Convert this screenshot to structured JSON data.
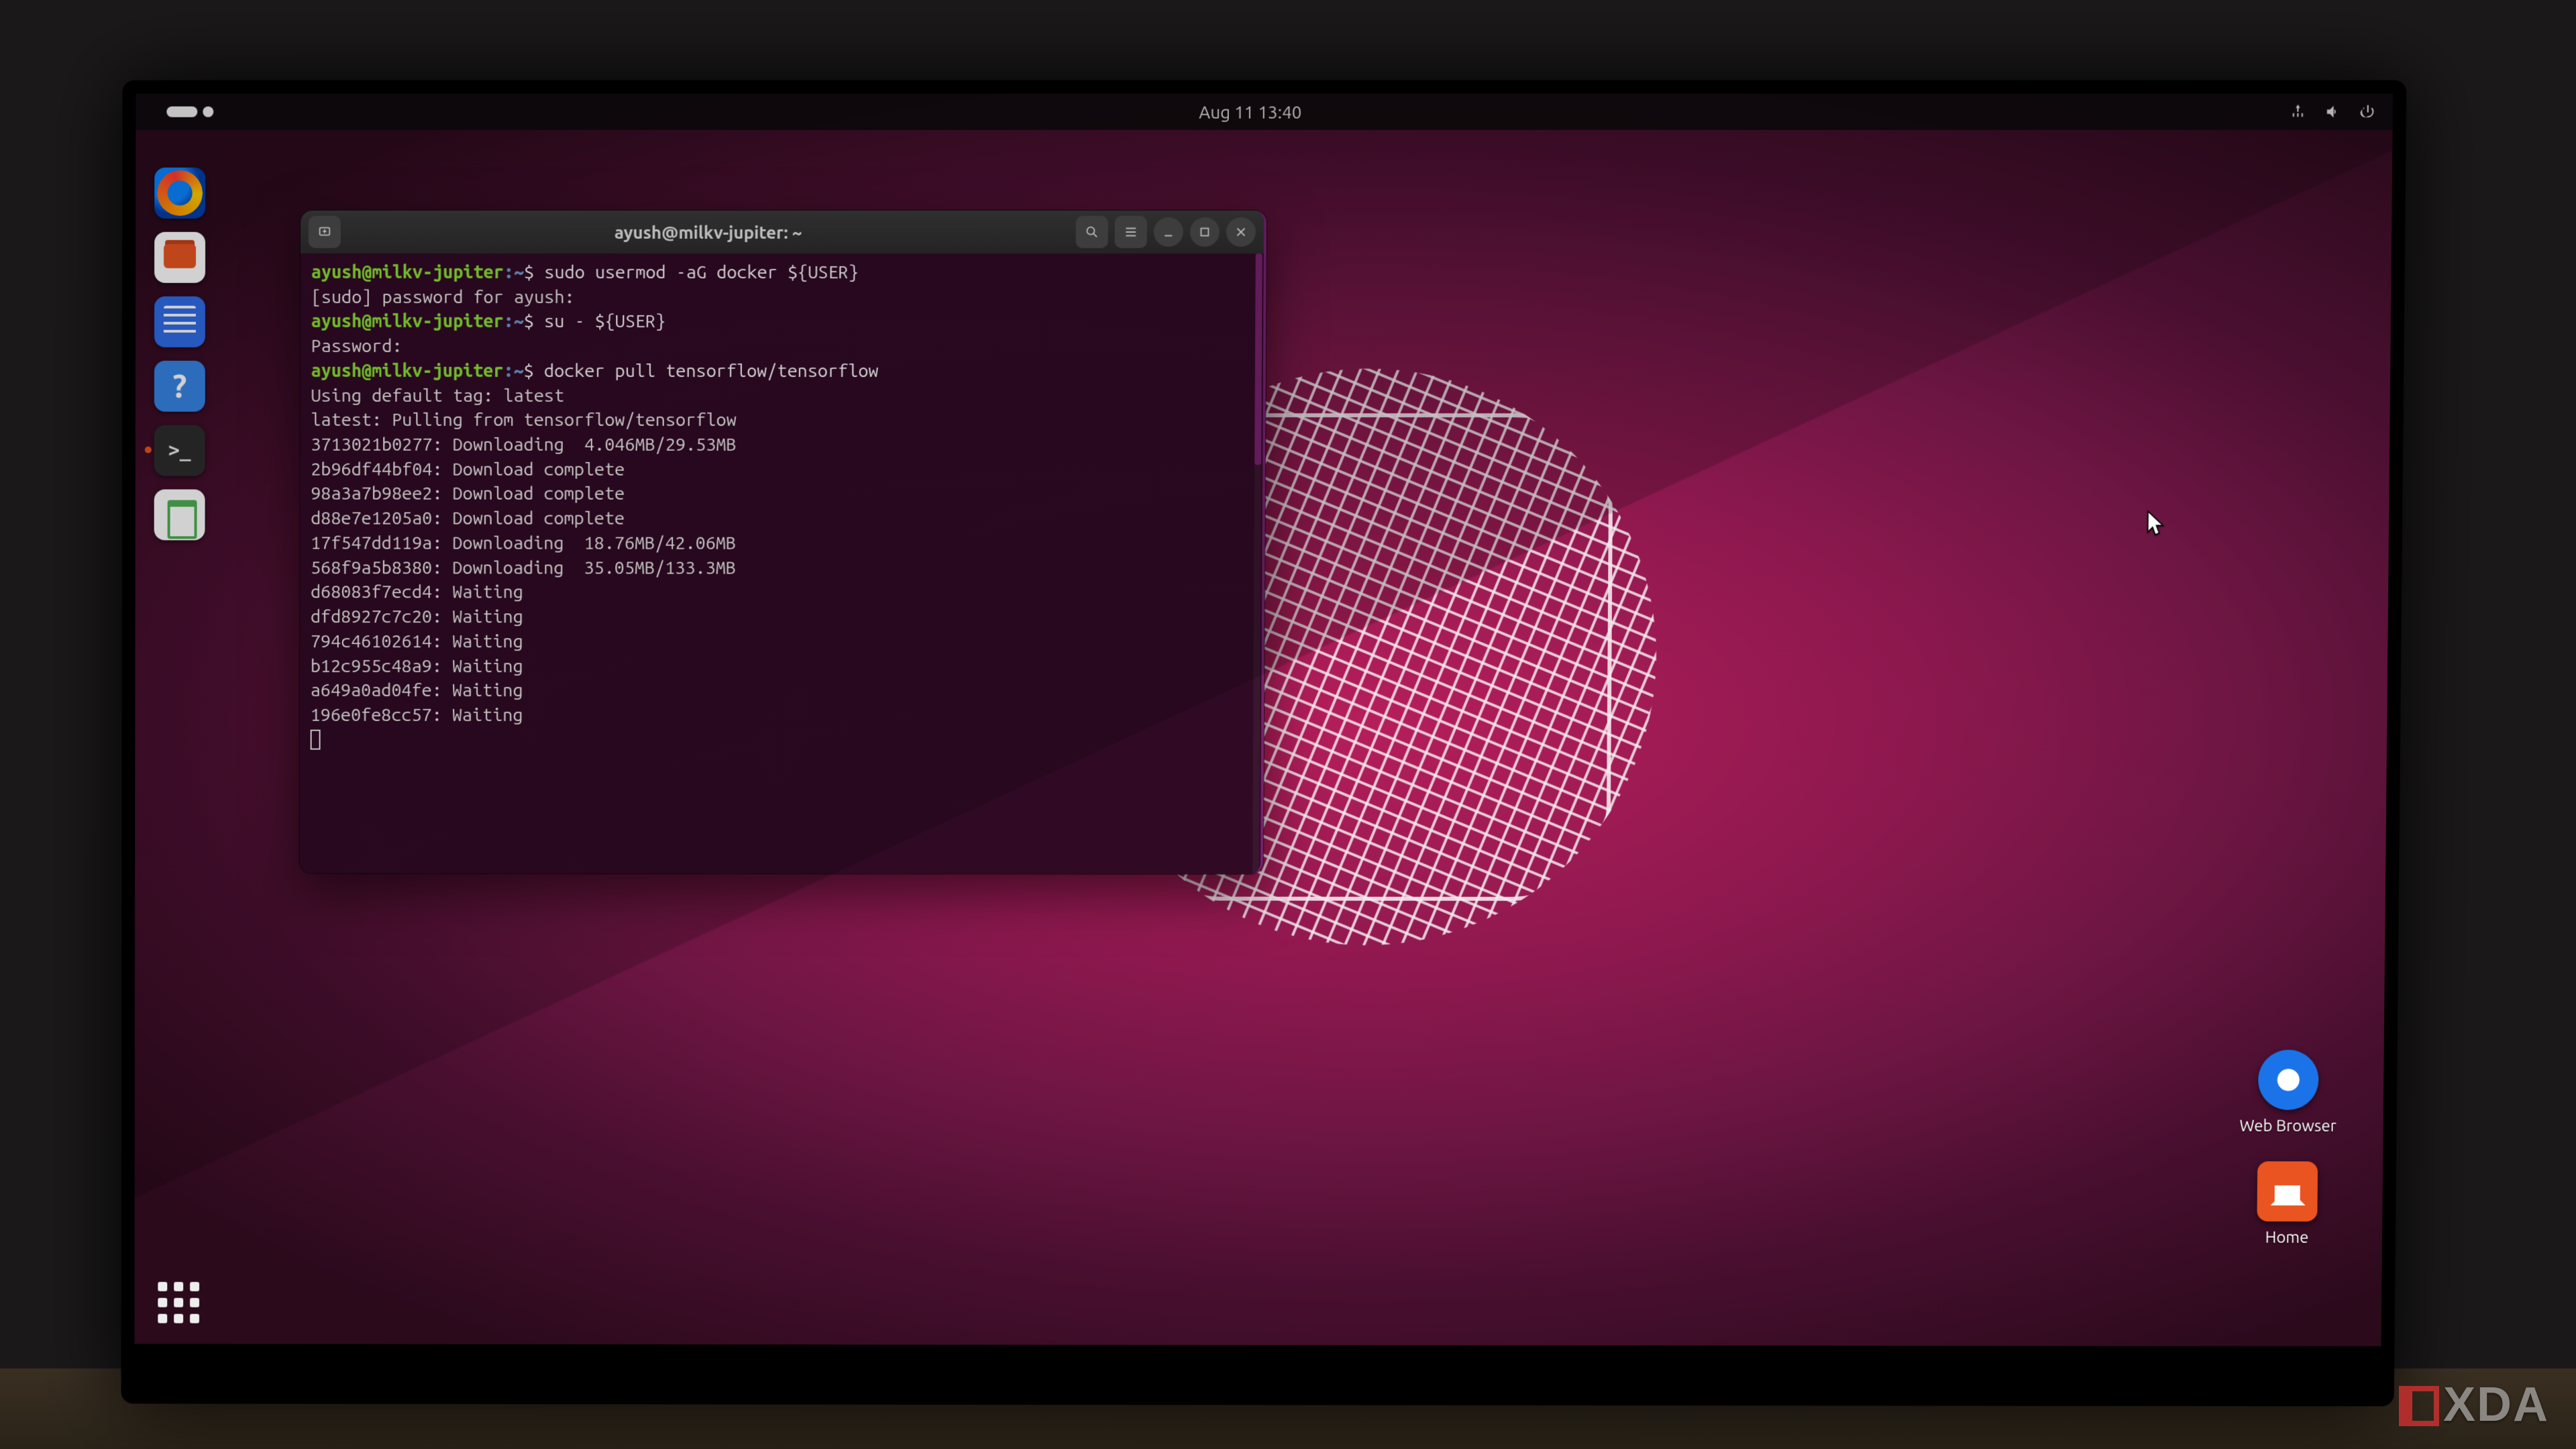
{
  "topbar": {
    "datetime": "Aug 11  13:40"
  },
  "dock": {
    "items": [
      {
        "name": "firefox-icon"
      },
      {
        "name": "files-icon"
      },
      {
        "name": "libreoffice-writer-icon"
      },
      {
        "name": "help-icon",
        "glyph": "?"
      },
      {
        "name": "terminal-icon"
      },
      {
        "name": "trash-icon"
      }
    ],
    "showapps_name": "show-applications-button"
  },
  "desktop": {
    "web_browser_label": "Web Browser",
    "home_label": "Home"
  },
  "terminal": {
    "title": "ayush@milkv-jupiter: ~",
    "prompt_user": "ayush@milkv-jupiter",
    "prompt_path": "~",
    "prompt_sep": ":",
    "prompt_sigil": "$",
    "lines": [
      {
        "type": "prompt",
        "cmd": "sudo usermod -aG docker ${USER}"
      },
      {
        "type": "out",
        "text": "[sudo] password for ayush:"
      },
      {
        "type": "prompt",
        "cmd": "su - ${USER}"
      },
      {
        "type": "out",
        "text": "Password:"
      },
      {
        "type": "prompt",
        "cmd": "docker pull tensorflow/tensorflow"
      },
      {
        "type": "out",
        "text": "Using default tag: latest"
      },
      {
        "type": "out",
        "text": "latest: Pulling from tensorflow/tensorflow"
      },
      {
        "type": "out",
        "text": "3713021b0277: Downloading  4.046MB/29.53MB"
      },
      {
        "type": "out",
        "text": "2b96df44bf04: Download complete"
      },
      {
        "type": "out",
        "text": "98a3a7b98ee2: Download complete"
      },
      {
        "type": "out",
        "text": "d88e7e1205a0: Download complete"
      },
      {
        "type": "out",
        "text": "17f547dd119a: Downloading  18.76MB/42.06MB"
      },
      {
        "type": "out",
        "text": "568f9a5b8380: Downloading  35.05MB/133.3MB"
      },
      {
        "type": "out",
        "text": "d68083f7ecd4: Waiting"
      },
      {
        "type": "out",
        "text": "dfd8927c7c20: Waiting"
      },
      {
        "type": "out",
        "text": "794c46102614: Waiting"
      },
      {
        "type": "out",
        "text": "b12c955c48a9: Waiting"
      },
      {
        "type": "out",
        "text": "a649a0ad04fe: Waiting"
      },
      {
        "type": "out",
        "text": "196e0fe8cc57: Waiting"
      }
    ]
  },
  "watermark": "XDA"
}
